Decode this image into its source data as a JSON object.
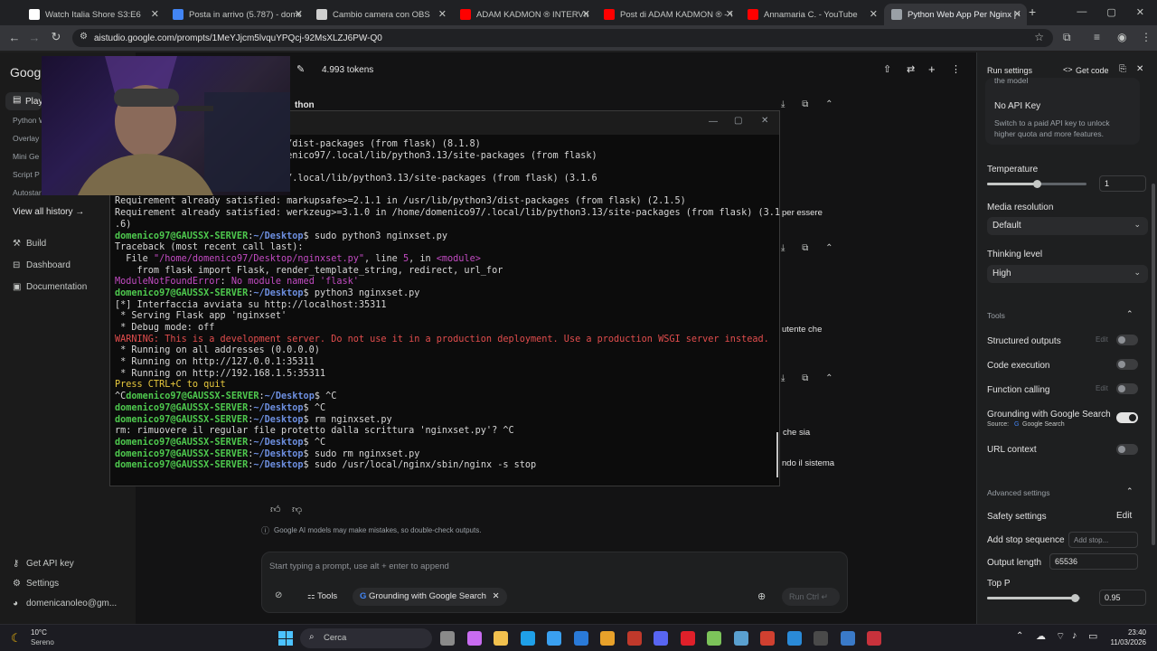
{
  "browser": {
    "tabs": [
      {
        "title": "Watch Italia Shore S3:E6",
        "color": "#ffffff"
      },
      {
        "title": "Posta in arrivo (5.787) - domen",
        "color": "#4285f4"
      },
      {
        "title": "Cambio camera con OBS",
        "color": "#cfcfcf"
      },
      {
        "title": "ADAM KADMON ® INTERVISTA",
        "color": "#ff0000"
      },
      {
        "title": "Post di ADAM KADMON ® - Yo",
        "color": "#ff0000"
      },
      {
        "title": "Annamaria C. - YouTube",
        "color": "#ff0000"
      },
      {
        "title": "Python Web App Per Nginx | G",
        "color": "#9aa0a6"
      }
    ],
    "new_tab": "+",
    "url": "aistudio.google.com/prompts/1MeYJjcm5lvquYPQcj-92MsXLZJ6PW-Q0"
  },
  "left_nav": {
    "logo": "Googl",
    "playground": "Play",
    "history_items": [
      "Python W",
      "Overlay",
      "Mini Ge",
      "Script P",
      "Autostar"
    ],
    "view_all": "View all history →",
    "build": "Build",
    "dashboard": "Dashboard",
    "documentation": "Documentation",
    "get_api_key": "Get API key",
    "settings": "Settings",
    "account": "domenicanoleo@gm..."
  },
  "topbar": {
    "tokens": "4.993 tokens"
  },
  "main": {
    "section_title_fragment": "thon",
    "fragments": [
      "per essere",
      "utente che",
      "che sia",
      "ndo il sistema"
    ],
    "disclaimer": "Google AI models may make mistakes, so double-check outputs.",
    "prompt_placeholder": "Start typing a prompt, use alt + enter to append",
    "tools_label": "Tools",
    "grounding_chip": "Grounding with Google Search",
    "run_label": "Run Ctrl ↵"
  },
  "terminal": {
    "lines": [
      [
        {
          "t": "lick>=8.1.3 in /usr/lib/python3/dist-packages (from flask) (8.1.8)",
          "c": ""
        }
      ],
      [
        {
          "t": "tsdangerous>=2.2.0 in /home/domenico97/.local/lib/python3.13/site-packages (from flask)",
          "c": ""
        }
      ],
      [
        {
          "t": "",
          "c": ""
        }
      ],
      [
        {
          "t": "nja2>=3.1.2 in /home/domenico97/.local/lib/python3.13/site-packages (from flask) (3.1.6",
          "c": ""
        }
      ],
      [
        {
          "t": "",
          "c": ""
        }
      ],
      [
        {
          "t": "Requirement already satisfied: markupsafe>=2.1.1 in /usr/lib/python3/dist-packages (from flask) (2.1.5)",
          "c": ""
        }
      ],
      [
        {
          "t": "Requirement already satisfied: werkzeug>=3.1.0 in /home/domenico97/.local/lib/python3.13/site-packages (from flask) (3.1",
          "c": ""
        }
      ],
      [
        {
          "t": ".6)",
          "c": ""
        }
      ],
      [
        {
          "t": "domenico97@GAUSSX-SERVER",
          "c": "g"
        },
        {
          "t": ":",
          "c": ""
        },
        {
          "t": "~/Desktop",
          "c": "b"
        },
        {
          "t": "$ sudo python3 nginxset.py",
          "c": ""
        }
      ],
      [
        {
          "t": "Traceback (most recent call last):",
          "c": ""
        }
      ],
      [
        {
          "t": "  File ",
          "c": ""
        },
        {
          "t": "\"/home/domenico97/Desktop/nginxset.py\"",
          "c": "m"
        },
        {
          "t": ", line ",
          "c": ""
        },
        {
          "t": "5",
          "c": "m"
        },
        {
          "t": ", in ",
          "c": ""
        },
        {
          "t": "<module>",
          "c": "m"
        }
      ],
      [
        {
          "t": "    from flask import Flask, render_template_string, redirect, url_for",
          "c": ""
        }
      ],
      [
        {
          "t": "ModuleNotFoundError",
          "c": "m"
        },
        {
          "t": ": ",
          "c": ""
        },
        {
          "t": "No module named 'flask'",
          "c": "m"
        }
      ],
      [
        {
          "t": "domenico97@GAUSSX-SERVER",
          "c": "g"
        },
        {
          "t": ":",
          "c": ""
        },
        {
          "t": "~/Desktop",
          "c": "b"
        },
        {
          "t": "$ python3 nginxset.py",
          "c": ""
        }
      ],
      [
        {
          "t": "[*] Interfaccia avviata su http://localhost:35311",
          "c": ""
        }
      ],
      [
        {
          "t": " * Serving Flask app 'nginxset'",
          "c": ""
        }
      ],
      [
        {
          "t": " * Debug mode: off",
          "c": ""
        }
      ],
      [
        {
          "t": "WARNING: This is a development server. Do not use it in a production deployment. Use a production WSGI server instead.",
          "c": "r"
        }
      ],
      [
        {
          "t": " * Running on all addresses (0.0.0.0)",
          "c": ""
        }
      ],
      [
        {
          "t": " * Running on http://127.0.0.1:35311",
          "c": ""
        }
      ],
      [
        {
          "t": " * Running on http://192.168.1.5:35311",
          "c": ""
        }
      ],
      [
        {
          "t": "Press CTRL+C to quit",
          "c": "y"
        }
      ],
      [
        {
          "t": "^C",
          "c": ""
        },
        {
          "t": "domenico97@GAUSSX-SERVER",
          "c": "g"
        },
        {
          "t": ":",
          "c": ""
        },
        {
          "t": "~/Desktop",
          "c": "b"
        },
        {
          "t": "$ ^C",
          "c": ""
        }
      ],
      [
        {
          "t": "domenico97@GAUSSX-SERVER",
          "c": "g"
        },
        {
          "t": ":",
          "c": ""
        },
        {
          "t": "~/Desktop",
          "c": "b"
        },
        {
          "t": "$ ^C",
          "c": ""
        }
      ],
      [
        {
          "t": "domenico97@GAUSSX-SERVER",
          "c": "g"
        },
        {
          "t": ":",
          "c": ""
        },
        {
          "t": "~/Desktop",
          "c": "b"
        },
        {
          "t": "$ rm nginxset.py",
          "c": ""
        }
      ],
      [
        {
          "t": "rm: rimuovere il regular file protetto dalla scrittura 'nginxset.py'? ^C",
          "c": ""
        }
      ],
      [
        {
          "t": "domenico97@GAUSSX-SERVER",
          "c": "g"
        },
        {
          "t": ":",
          "c": ""
        },
        {
          "t": "~/Desktop",
          "c": "b"
        },
        {
          "t": "$ ^C",
          "c": ""
        }
      ],
      [
        {
          "t": "domenico97@GAUSSX-SERVER",
          "c": "g"
        },
        {
          "t": ":",
          "c": ""
        },
        {
          "t": "~/Desktop",
          "c": "b"
        },
        {
          "t": "$ sudo rm nginxset.py",
          "c": ""
        }
      ],
      [
        {
          "t": "domenico97@GAUSSX-SERVER",
          "c": "g"
        },
        {
          "t": ":",
          "c": ""
        },
        {
          "t": "~/Desktop",
          "c": "b"
        },
        {
          "t": "$ sudo /usr/local/nginx/sbin/nginx -s stop",
          "c": ""
        }
      ]
    ]
  },
  "run_settings": {
    "title": "Run settings",
    "get_code": "Get code",
    "model_fragment": "the model",
    "api_key_title": "No API Key",
    "api_key_desc": "Switch to a paid API key to unlock higher quota and more features.",
    "temperature_label": "Temperature",
    "temperature_value": "1",
    "temperature_fraction": 0.5,
    "media_resolution_label": "Media resolution",
    "media_resolution_value": "Default",
    "thinking_level_label": "Thinking level",
    "thinking_level_value": "High",
    "tools_header": "Tools",
    "structured_outputs": "Structured outputs",
    "code_execution": "Code execution",
    "function_calling": "Function calling",
    "edit_label": "Edit",
    "grounding": "Grounding with Google Search",
    "grounding_source": "Source:",
    "grounding_source_name": "Google Search",
    "url_context": "URL context",
    "advanced_header": "Advanced settings",
    "safety_settings": "Safety settings",
    "safety_edit": "Edit",
    "stop_sequence": "Add stop sequence",
    "stop_placeholder": "Add stop...",
    "output_length": "Output length",
    "output_length_value": "65536",
    "top_p_label": "Top P",
    "top_p_value": "0.95",
    "top_p_fraction": 0.95
  },
  "taskbar": {
    "weather_temp": "10°C",
    "weather_desc": "Sereno",
    "search": "Cerca",
    "time": "23:40",
    "date": "11/03/2026"
  }
}
